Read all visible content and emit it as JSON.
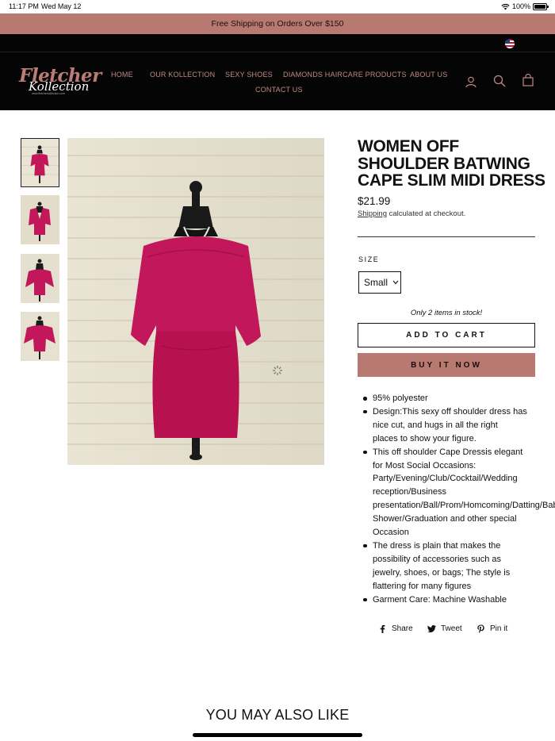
{
  "status_bar": {
    "time": "11:17 PM",
    "date": "Wed May 12",
    "battery": "100%"
  },
  "announcement": "Free Shipping on Orders Over $150",
  "header": {
    "logo": {
      "line1": "Fletcher",
      "line2": "Kollection",
      "line3": "www.fletcherkollection.com"
    },
    "nav": {
      "home": "HOME",
      "kollection": "OUR KOLLECTION",
      "shoes": "SEXY SHOES",
      "haircare": "DIAMONDS HAIRCARE PRODUCTS",
      "about": "ABOUT US",
      "contact": "CONTACT US"
    },
    "icons": [
      "account-icon",
      "search-icon",
      "cart-icon"
    ]
  },
  "product": {
    "title": "WOMEN OFF SHOULDER BATWING CAPE SLIM MIDI DRESS",
    "price": "$21.99",
    "shipping_link": "Shipping",
    "shipping_rest": " calculated at checkout.",
    "size_label": "SIZE",
    "size_value": "Small",
    "stock_note": "Only 2 items in stock!",
    "add_to_cart": "ADD TO CART",
    "buy_now": "BUY IT NOW",
    "description": [
      "95% polyester",
      "Design:This sexy off shoulder dress has\nnice cut, and hugs in all the right\nplaces to show your figure.",
      "This off shoulder Cape Dressis elegant\nfor Most Social Occasions:\nParty/Evening/Club/Cocktail/Wedding\nreception/Business\npresentation/Ball/Prom/Homcoming/Datting/Baby\nShower/Graduation and other special\nOccasion",
      "The dress is plain that makes the\npossibility of accessories such as\njewelry, shoes, or bags; The style is\nflattering for many figures",
      "Garment Care: Machine Washable"
    ],
    "thumbnails": 4
  },
  "social": {
    "share": "Share",
    "tweet": "Tweet",
    "pin": "Pin it"
  },
  "you_may_also_like": "YOU MAY ALSO LIKE",
  "colors": {
    "accent": "#b87a70",
    "header_bg": "#050505",
    "dress": "#c2185b",
    "nav_text": "#c08a82"
  }
}
